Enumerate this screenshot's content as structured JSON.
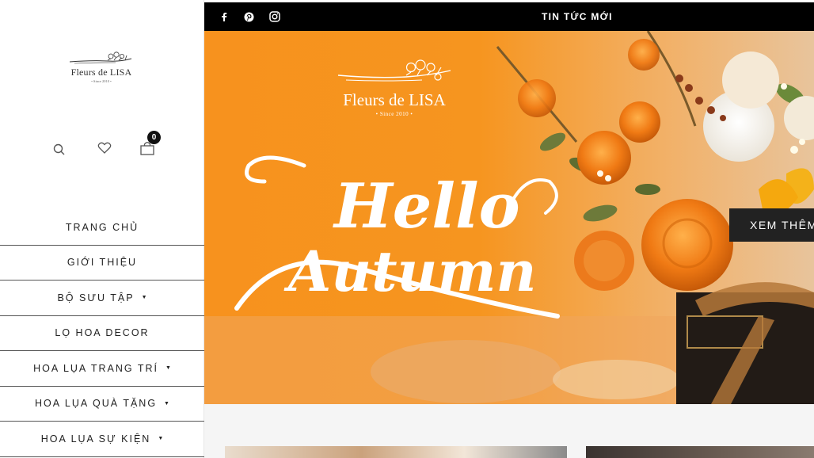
{
  "sidebar": {
    "logo": {
      "brand": "Fleurs de LISA",
      "since": "• Since 2010 •"
    },
    "utilities": {
      "cart_count": "0"
    },
    "nav": [
      {
        "label": "TRANG CHỦ",
        "has_dropdown": false
      },
      {
        "label": "GIỚI THIỆU",
        "has_dropdown": false
      },
      {
        "label": "BỘ SƯU TẬP",
        "has_dropdown": true
      },
      {
        "label": "LỌ HOA DECOR",
        "has_dropdown": false
      },
      {
        "label": "HOA LỤA TRANG TRÍ",
        "has_dropdown": true
      },
      {
        "label": "HOA LỤA QUÀ TẶNG",
        "has_dropdown": true
      },
      {
        "label": "HOA LỤA SỰ KIỆN",
        "has_dropdown": true
      }
    ]
  },
  "topbar": {
    "social": [
      "facebook-icon",
      "pinterest-icon",
      "instagram-icon"
    ],
    "news_label": "TIN TỨC MỚI"
  },
  "hero": {
    "logo": {
      "brand": "Fleurs de LISA",
      "since": "• Since 2010 •"
    },
    "headline_line1": "Hello",
    "headline_line2": "Autumn",
    "cta_label": "XEM THÊM",
    "accent_color": "#f7921e"
  }
}
